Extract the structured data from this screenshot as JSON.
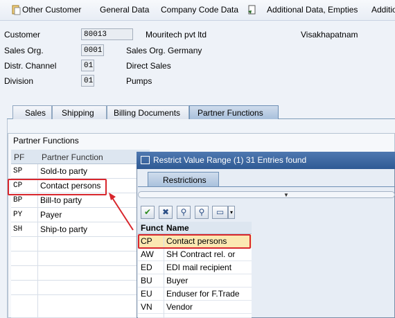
{
  "toolbar": {
    "other_customer": "Other Customer",
    "general_data": "General Data",
    "company_code_data": "Company Code Data",
    "additional_data": "Additional Data, Empties",
    "additional_cut": "Additio"
  },
  "header": {
    "customer_label": "Customer",
    "customer_value": "80013",
    "customer_name": "Mouritech pvt ltd",
    "customer_city": "Visakhapatnam",
    "sales_org_label": "Sales Org.",
    "sales_org_value": "0001",
    "sales_org_text": "Sales Org. Germany",
    "distr_label": "Distr. Channel",
    "distr_value": "01",
    "distr_text": "Direct Sales",
    "division_label": "Division",
    "division_value": "01",
    "division_text": "Pumps"
  },
  "tabs": [
    "Sales",
    "Shipping",
    "Billing Documents",
    "Partner Functions"
  ],
  "partner_functions": {
    "group_title": "Partner Functions",
    "columns": [
      "PF",
      "Partner Function"
    ],
    "rows": [
      {
        "code": "SP",
        "name": "Sold-to party"
      },
      {
        "code": "CP",
        "name": "Contact persons"
      },
      {
        "code": "BP",
        "name": "Bill-to party"
      },
      {
        "code": "PY",
        "name": "Payer"
      },
      {
        "code": "SH",
        "name": "Ship-to party"
      }
    ]
  },
  "popup": {
    "title": "Restrict Value Range (1)   31 Entries found",
    "restrictions_tab": "Restrictions",
    "columns": [
      "Funct",
      "Name"
    ],
    "rows": [
      {
        "code": "CP",
        "name": "Contact persons"
      },
      {
        "code": "AW",
        "name": "SH Contract rel. or"
      },
      {
        "code": "ED",
        "name": "EDI mail recipient"
      },
      {
        "code": "BU",
        "name": "Buyer"
      },
      {
        "code": "EU",
        "name": "Enduser for F.Trade"
      },
      {
        "code": "VN",
        "name": "Vendor"
      }
    ]
  },
  "colors": {
    "highlight": "#d8262c",
    "selected_row": "#fbe8b2",
    "popup_title_bar": "#2f5a94"
  }
}
